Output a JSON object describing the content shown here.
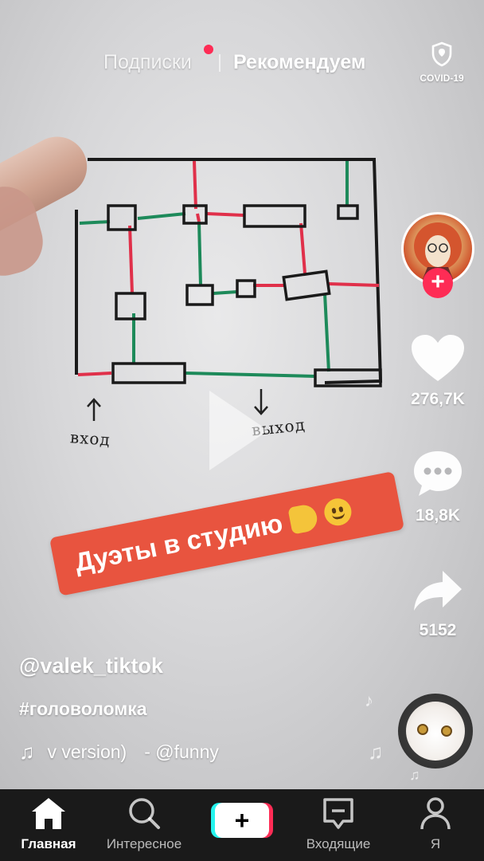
{
  "header": {
    "tab_following": "Подписки",
    "tab_foryou": "Рекомендуем",
    "covid_label": "COVID-19"
  },
  "video": {
    "entrance_label": "вход",
    "exit_label": "выход",
    "sticker_text": "Дуэты в студию"
  },
  "rail": {
    "likes": "276,7K",
    "comments": "18,8K",
    "shares": "5152"
  },
  "caption": {
    "username": "@valek_tiktok",
    "hashtag": "#головоломка",
    "music_title": "v version)",
    "music_author": "- @funny"
  },
  "nav": {
    "home": "Главная",
    "discover": "Интересное",
    "create": "+",
    "inbox": "Входящие",
    "me": "Я"
  },
  "icons": {
    "covid": "shield-icon",
    "like": "heart-icon",
    "comment": "comment-icon",
    "share": "share-arrow-icon",
    "music": "music-note-icon",
    "home": "home-icon",
    "discover": "search-icon",
    "inbox": "inbox-icon",
    "me": "user-icon"
  },
  "colors": {
    "accent": "#fe2c55",
    "accent_cyan": "#25f4ee",
    "sticker": "#e8543f",
    "nav_bg": "#1a1a1a"
  }
}
